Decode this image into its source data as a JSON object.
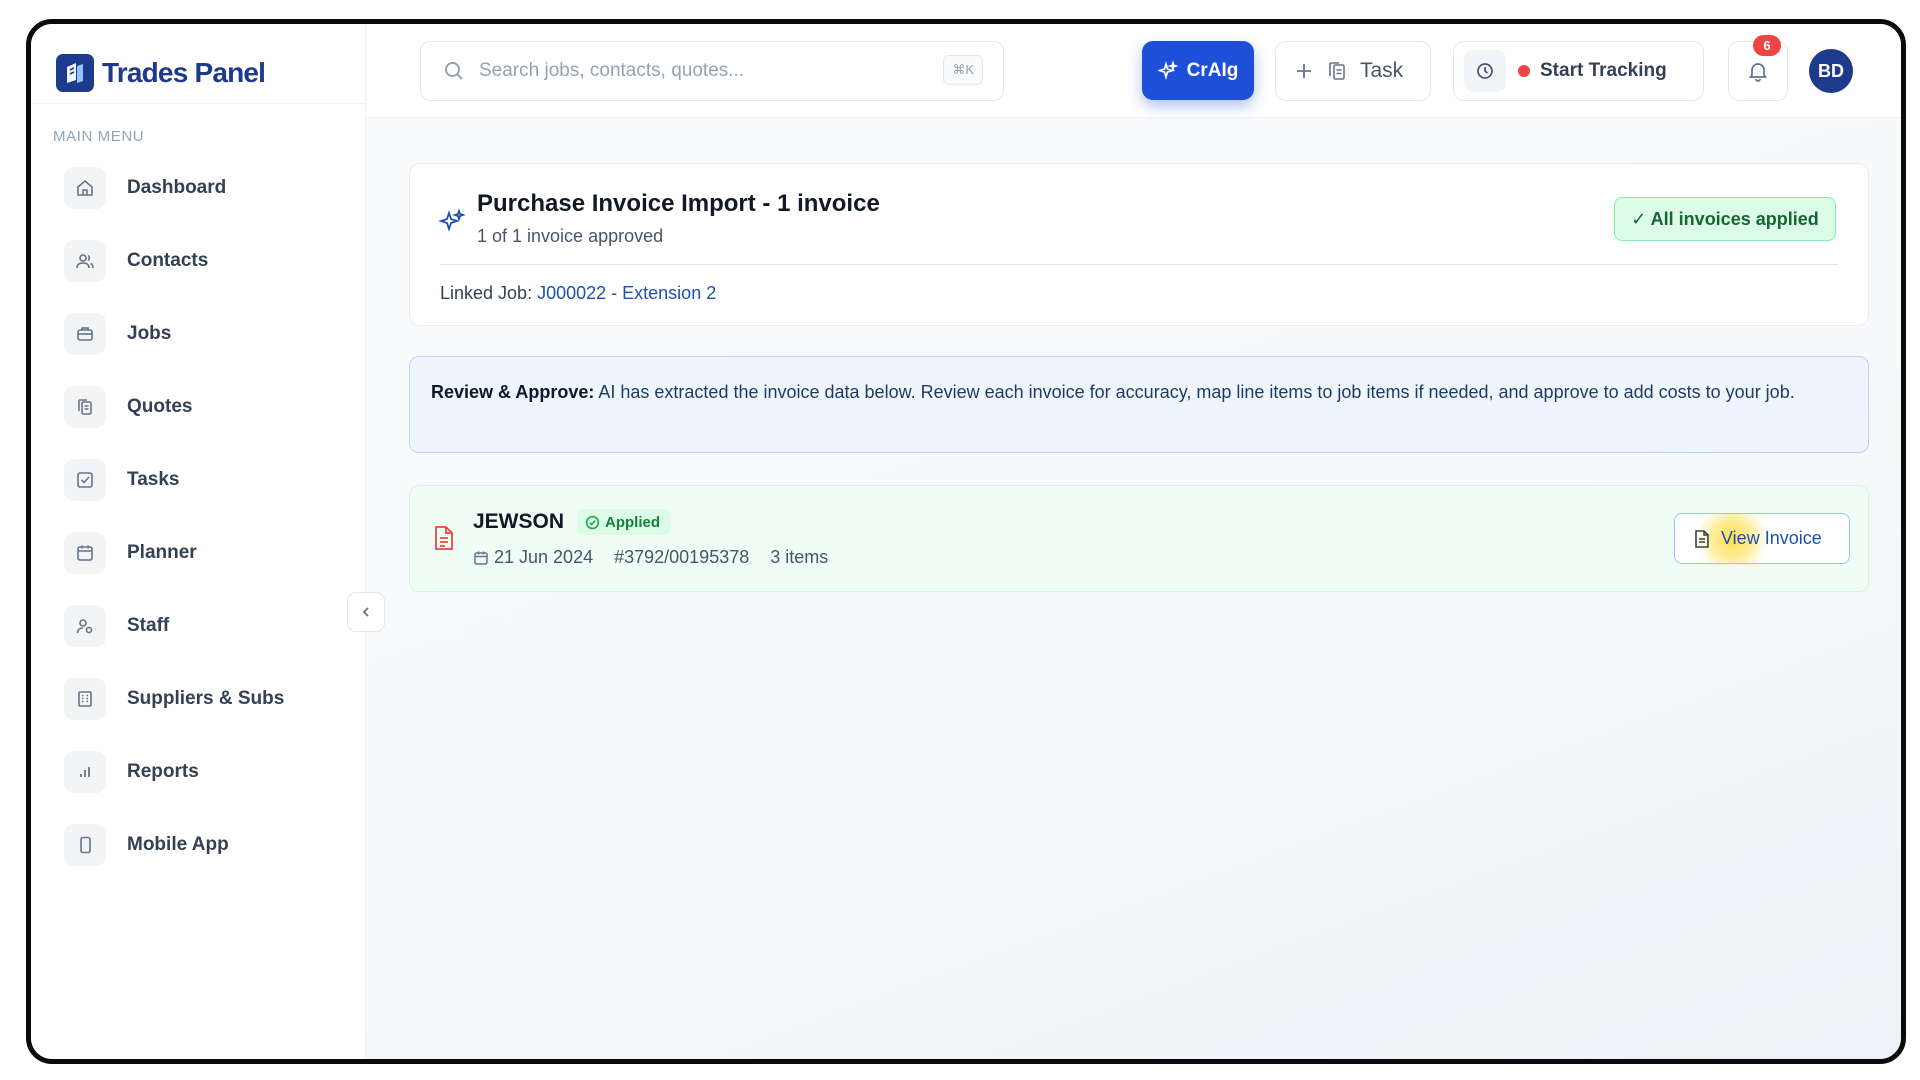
{
  "brand": {
    "name": "Trades Panel"
  },
  "sidebar": {
    "heading": "MAIN MENU",
    "items": [
      {
        "label": "Dashboard",
        "icon": "home-icon"
      },
      {
        "label": "Contacts",
        "icon": "users-icon"
      },
      {
        "label": "Jobs",
        "icon": "briefcase-icon"
      },
      {
        "label": "Quotes",
        "icon": "documents-icon"
      },
      {
        "label": "Tasks",
        "icon": "checkbox-icon"
      },
      {
        "label": "Planner",
        "icon": "calendar-icon"
      },
      {
        "label": "Staff",
        "icon": "staff-icon"
      },
      {
        "label": "Suppliers & Subs",
        "icon": "building-icon"
      },
      {
        "label": "Reports",
        "icon": "bar-chart-icon"
      },
      {
        "label": "Mobile App",
        "icon": "phone-icon"
      }
    ]
  },
  "topbar": {
    "search_placeholder": "Search jobs, contacts, quotes...",
    "search_shortcut": "⌘K",
    "craig_label": "CrAIg",
    "task_label": "Task",
    "tracking_label": "Start Tracking",
    "notification_count": "6",
    "avatar_initials": "BD"
  },
  "import": {
    "title": "Purchase Invoice Import - 1 invoice",
    "subtitle": "1 of 1 invoice approved",
    "status_badge": "✓ All invoices applied",
    "linked_label": "Linked Job:",
    "linked_job": "J000022 - Extension 2"
  },
  "notice": {
    "strong": "Review & Approve:",
    "text": " AI has extracted the invoice data below. Review each invoice for accuracy, map line items to job items if needed, and approve to add costs to your job."
  },
  "invoice": {
    "supplier": "JEWSON",
    "status": "Applied",
    "date": "21 Jun 2024",
    "number": "#3792/00195378",
    "items": "3 items",
    "view_label": "View Invoice"
  },
  "colors": {
    "brand": "#1e3a8a",
    "accent": "#1e4fd8",
    "success": "#16a34a",
    "danger": "#ef4444"
  }
}
